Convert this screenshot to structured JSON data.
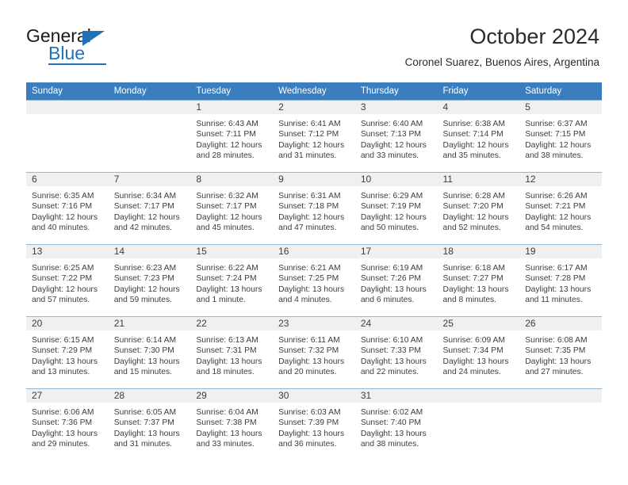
{
  "logo": {
    "word_top": "General",
    "word_bottom": "Blue",
    "accent_color": "#1f72b8"
  },
  "header": {
    "title": "October 2024",
    "subtitle": "Coronel Suarez, Buenos Aires, Argentina"
  },
  "theme": {
    "header_row_bg": "#3a7ebf",
    "header_row_text": "#ffffff",
    "daynum_band_bg": "#f0f0f0",
    "grid_line": "#97b8d4",
    "body_text": "#3d3d3d"
  },
  "labels": {
    "sunrise_prefix": "Sunrise:",
    "sunset_prefix": "Sunset:",
    "daylight_prefix": "Daylight:"
  },
  "weekday_headers": [
    "Sunday",
    "Monday",
    "Tuesday",
    "Wednesday",
    "Thursday",
    "Friday",
    "Saturday"
  ],
  "weeks": [
    [
      {
        "day": "",
        "empty": true
      },
      {
        "day": "",
        "empty": true
      },
      {
        "day": "1",
        "sunrise": "Sunrise: 6:43 AM",
        "sunset": "Sunset: 7:11 PM",
        "daylight": "Daylight: 12 hours and 28 minutes."
      },
      {
        "day": "2",
        "sunrise": "Sunrise: 6:41 AM",
        "sunset": "Sunset: 7:12 PM",
        "daylight": "Daylight: 12 hours and 31 minutes."
      },
      {
        "day": "3",
        "sunrise": "Sunrise: 6:40 AM",
        "sunset": "Sunset: 7:13 PM",
        "daylight": "Daylight: 12 hours and 33 minutes."
      },
      {
        "day": "4",
        "sunrise": "Sunrise: 6:38 AM",
        "sunset": "Sunset: 7:14 PM",
        "daylight": "Daylight: 12 hours and 35 minutes."
      },
      {
        "day": "5",
        "sunrise": "Sunrise: 6:37 AM",
        "sunset": "Sunset: 7:15 PM",
        "daylight": "Daylight: 12 hours and 38 minutes."
      }
    ],
    [
      {
        "day": "6",
        "sunrise": "Sunrise: 6:35 AM",
        "sunset": "Sunset: 7:16 PM",
        "daylight": "Daylight: 12 hours and 40 minutes."
      },
      {
        "day": "7",
        "sunrise": "Sunrise: 6:34 AM",
        "sunset": "Sunset: 7:17 PM",
        "daylight": "Daylight: 12 hours and 42 minutes."
      },
      {
        "day": "8",
        "sunrise": "Sunrise: 6:32 AM",
        "sunset": "Sunset: 7:17 PM",
        "daylight": "Daylight: 12 hours and 45 minutes."
      },
      {
        "day": "9",
        "sunrise": "Sunrise: 6:31 AM",
        "sunset": "Sunset: 7:18 PM",
        "daylight": "Daylight: 12 hours and 47 minutes."
      },
      {
        "day": "10",
        "sunrise": "Sunrise: 6:29 AM",
        "sunset": "Sunset: 7:19 PM",
        "daylight": "Daylight: 12 hours and 50 minutes."
      },
      {
        "day": "11",
        "sunrise": "Sunrise: 6:28 AM",
        "sunset": "Sunset: 7:20 PM",
        "daylight": "Daylight: 12 hours and 52 minutes."
      },
      {
        "day": "12",
        "sunrise": "Sunrise: 6:26 AM",
        "sunset": "Sunset: 7:21 PM",
        "daylight": "Daylight: 12 hours and 54 minutes."
      }
    ],
    [
      {
        "day": "13",
        "sunrise": "Sunrise: 6:25 AM",
        "sunset": "Sunset: 7:22 PM",
        "daylight": "Daylight: 12 hours and 57 minutes."
      },
      {
        "day": "14",
        "sunrise": "Sunrise: 6:23 AM",
        "sunset": "Sunset: 7:23 PM",
        "daylight": "Daylight: 12 hours and 59 minutes."
      },
      {
        "day": "15",
        "sunrise": "Sunrise: 6:22 AM",
        "sunset": "Sunset: 7:24 PM",
        "daylight": "Daylight: 13 hours and 1 minute."
      },
      {
        "day": "16",
        "sunrise": "Sunrise: 6:21 AM",
        "sunset": "Sunset: 7:25 PM",
        "daylight": "Daylight: 13 hours and 4 minutes."
      },
      {
        "day": "17",
        "sunrise": "Sunrise: 6:19 AM",
        "sunset": "Sunset: 7:26 PM",
        "daylight": "Daylight: 13 hours and 6 minutes."
      },
      {
        "day": "18",
        "sunrise": "Sunrise: 6:18 AM",
        "sunset": "Sunset: 7:27 PM",
        "daylight": "Daylight: 13 hours and 8 minutes."
      },
      {
        "day": "19",
        "sunrise": "Sunrise: 6:17 AM",
        "sunset": "Sunset: 7:28 PM",
        "daylight": "Daylight: 13 hours and 11 minutes."
      }
    ],
    [
      {
        "day": "20",
        "sunrise": "Sunrise: 6:15 AM",
        "sunset": "Sunset: 7:29 PM",
        "daylight": "Daylight: 13 hours and 13 minutes."
      },
      {
        "day": "21",
        "sunrise": "Sunrise: 6:14 AM",
        "sunset": "Sunset: 7:30 PM",
        "daylight": "Daylight: 13 hours and 15 minutes."
      },
      {
        "day": "22",
        "sunrise": "Sunrise: 6:13 AM",
        "sunset": "Sunset: 7:31 PM",
        "daylight": "Daylight: 13 hours and 18 minutes."
      },
      {
        "day": "23",
        "sunrise": "Sunrise: 6:11 AM",
        "sunset": "Sunset: 7:32 PM",
        "daylight": "Daylight: 13 hours and 20 minutes."
      },
      {
        "day": "24",
        "sunrise": "Sunrise: 6:10 AM",
        "sunset": "Sunset: 7:33 PM",
        "daylight": "Daylight: 13 hours and 22 minutes."
      },
      {
        "day": "25",
        "sunrise": "Sunrise: 6:09 AM",
        "sunset": "Sunset: 7:34 PM",
        "daylight": "Daylight: 13 hours and 24 minutes."
      },
      {
        "day": "26",
        "sunrise": "Sunrise: 6:08 AM",
        "sunset": "Sunset: 7:35 PM",
        "daylight": "Daylight: 13 hours and 27 minutes."
      }
    ],
    [
      {
        "day": "27",
        "sunrise": "Sunrise: 6:06 AM",
        "sunset": "Sunset: 7:36 PM",
        "daylight": "Daylight: 13 hours and 29 minutes."
      },
      {
        "day": "28",
        "sunrise": "Sunrise: 6:05 AM",
        "sunset": "Sunset: 7:37 PM",
        "daylight": "Daylight: 13 hours and 31 minutes."
      },
      {
        "day": "29",
        "sunrise": "Sunrise: 6:04 AM",
        "sunset": "Sunset: 7:38 PM",
        "daylight": "Daylight: 13 hours and 33 minutes."
      },
      {
        "day": "30",
        "sunrise": "Sunrise: 6:03 AM",
        "sunset": "Sunset: 7:39 PM",
        "daylight": "Daylight: 13 hours and 36 minutes."
      },
      {
        "day": "31",
        "sunrise": "Sunrise: 6:02 AM",
        "sunset": "Sunset: 7:40 PM",
        "daylight": "Daylight: 13 hours and 38 minutes."
      },
      {
        "day": "",
        "empty": true
      },
      {
        "day": "",
        "empty": true
      }
    ]
  ]
}
